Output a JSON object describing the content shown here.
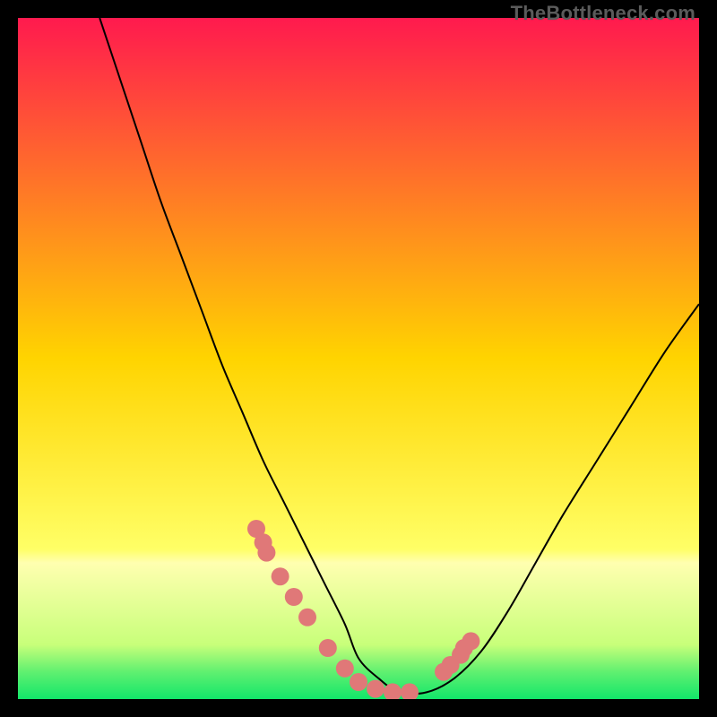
{
  "watermark": "TheBottleneck.com",
  "chart_data": {
    "type": "line",
    "title": "",
    "xlabel": "",
    "ylabel": "",
    "xlim": [
      0,
      100
    ],
    "ylim": [
      0,
      100
    ],
    "grid": false,
    "legend": false,
    "gradient_stops": [
      {
        "offset": 0.0,
        "color": "#ff1a4e"
      },
      {
        "offset": 0.5,
        "color": "#ffd400"
      },
      {
        "offset": 0.78,
        "color": "#ffff66"
      },
      {
        "offset": 0.8,
        "color": "#ffffb0"
      },
      {
        "offset": 0.92,
        "color": "#c8ff7a"
      },
      {
        "offset": 0.96,
        "color": "#60f070"
      },
      {
        "offset": 1.0,
        "color": "#12e66a"
      }
    ],
    "series": [
      {
        "name": "bottleneck-curve",
        "color": "#000000",
        "x": [
          12,
          15,
          18,
          21,
          24,
          27,
          30,
          33,
          36,
          39,
          42,
          45,
          48,
          50,
          53,
          56,
          60,
          64,
          68,
          72,
          76,
          80,
          85,
          90,
          95,
          100
        ],
        "y": [
          100,
          91,
          82,
          73,
          65,
          57,
          49,
          42,
          35,
          29,
          23,
          17,
          11,
          6,
          3,
          1,
          1,
          3,
          7,
          13,
          20,
          27,
          35,
          43,
          51,
          58
        ]
      }
    ],
    "points": {
      "name": "highlight-dots",
      "color": "#e07878",
      "radius": 10,
      "x": [
        35.0,
        36.0,
        36.5,
        38.5,
        40.5,
        42.5,
        45.5,
        48.0,
        50.0,
        52.5,
        55.0,
        57.5,
        62.5,
        63.5,
        65.0,
        65.5,
        66.5
      ],
      "y": [
        25.0,
        23.0,
        21.5,
        18.0,
        15.0,
        12.0,
        7.5,
        4.5,
        2.5,
        1.5,
        1.0,
        1.0,
        4.0,
        5.0,
        6.5,
        7.5,
        8.5
      ]
    }
  }
}
